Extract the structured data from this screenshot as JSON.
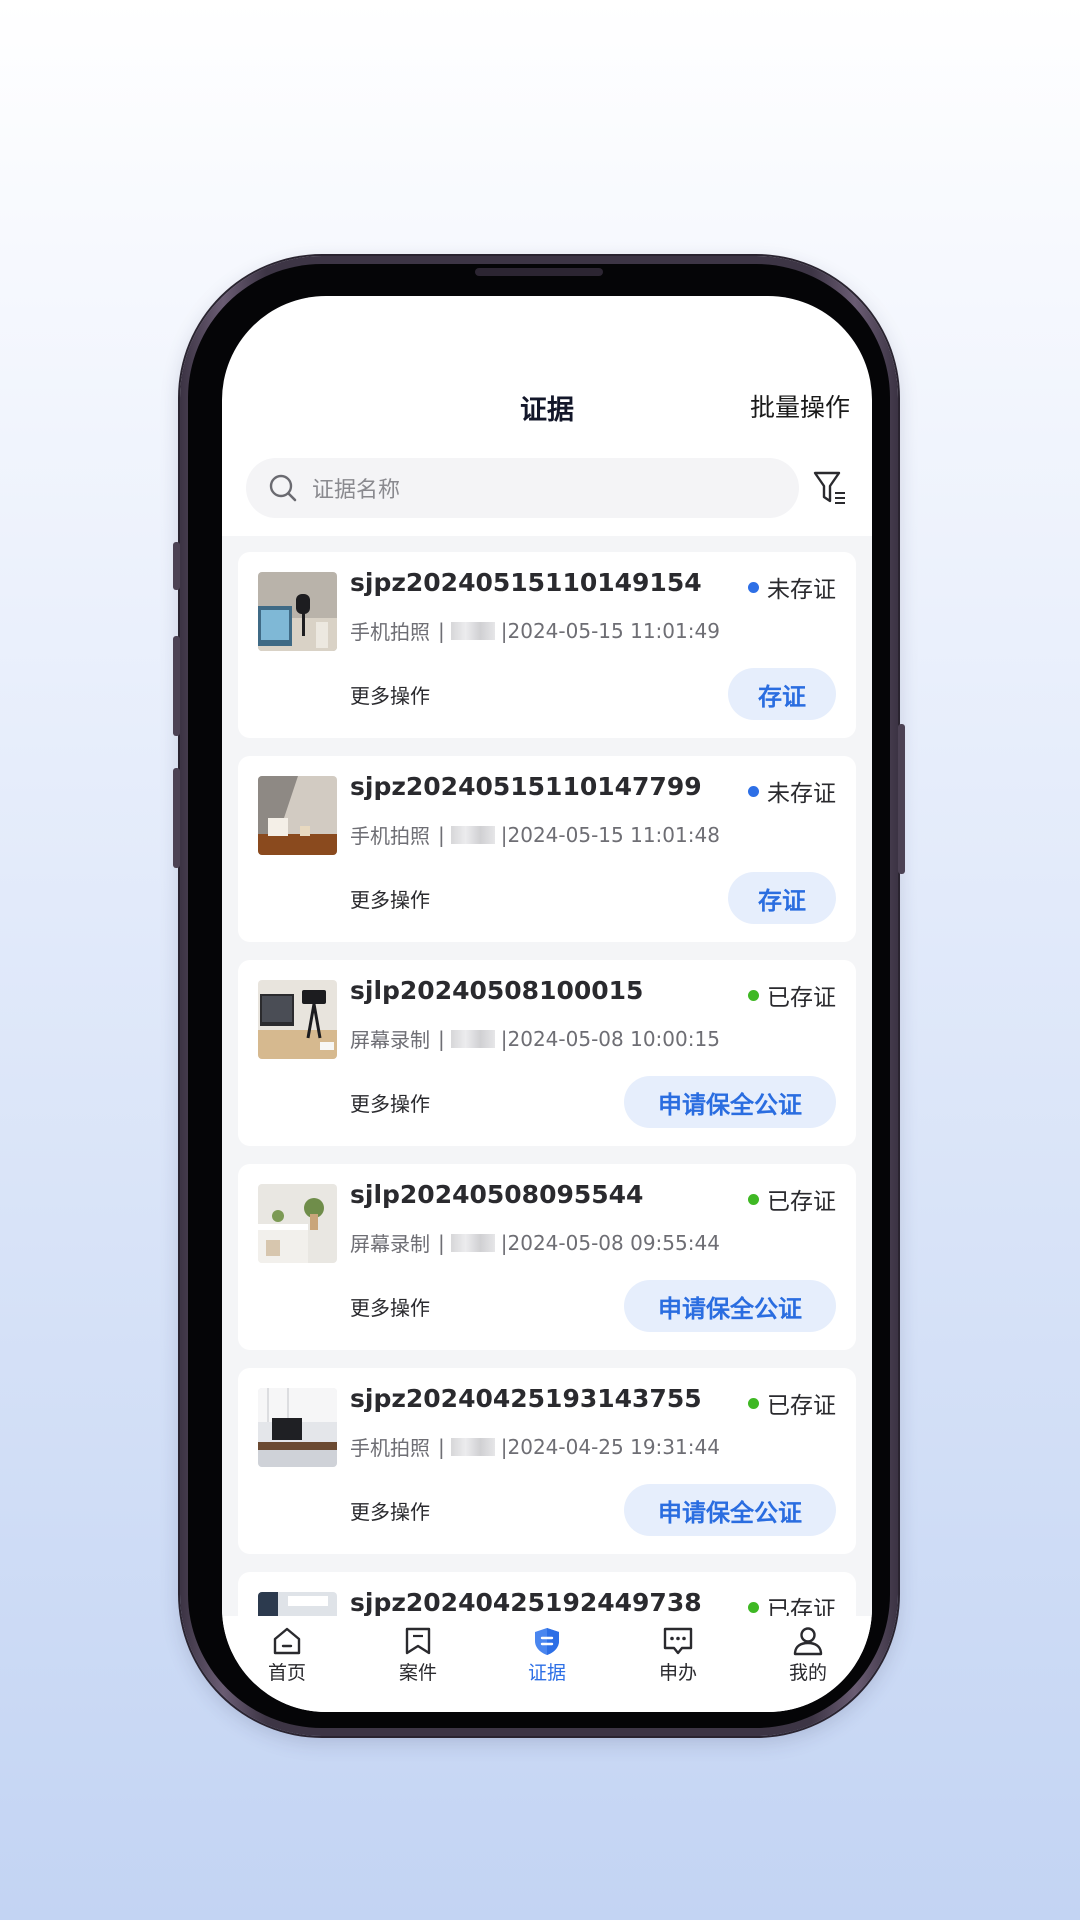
{
  "header": {
    "title": "证据",
    "batch_label": "批量操作"
  },
  "search": {
    "placeholder": "证据名称"
  },
  "evidence": [
    {
      "name": "sjpz20240515110149154",
      "status": "未存证",
      "status_color": "#2d6fe6",
      "source": "手机拍照",
      "separator": "|",
      "time": "2024-05-15 11:01:49",
      "more": "更多操作",
      "action": "存证",
      "thumb_icon": "desk-laptop-microphone-photo"
    },
    {
      "name": "sjpz20240515110147799",
      "status": "未存证",
      "status_color": "#2d6fe6",
      "source": "手机拍照",
      "separator": "|",
      "time": "2024-05-15 11:01:48",
      "more": "更多操作",
      "action": "存证",
      "thumb_icon": "desk-frame-photo"
    },
    {
      "name": "sjlp20240508100015",
      "status": "已存证",
      "status_color": "#3fb824",
      "source": "屏幕录制",
      "separator": "|",
      "time": "2024-05-08 10:00:15",
      "more": "更多操作",
      "action": "申请保全公证",
      "thumb_icon": "camera-tripod-photo"
    },
    {
      "name": "sjlp20240508095544",
      "status": "已存证",
      "status_color": "#3fb824",
      "source": "屏幕录制",
      "separator": "|",
      "time": "2024-05-08 09:55:44",
      "more": "更多操作",
      "action": "申请保全公证",
      "thumb_icon": "shelf-plant-photo"
    },
    {
      "name": "sjpz20240425193143755",
      "status": "已存证",
      "status_color": "#3fb824",
      "source": "手机拍照",
      "separator": "|",
      "time": "2024-04-25 19:31:44",
      "more": "更多操作",
      "action": "申请保全公证",
      "thumb_icon": "monitor-desk-photo"
    },
    {
      "name": "sjpz20240425192449738",
      "status": "已存证",
      "status_color": "#3fb824",
      "thumb_icon": "office-photo"
    }
  ],
  "tabs": [
    {
      "label": "首页",
      "icon": "home-icon"
    },
    {
      "label": "案件",
      "icon": "case-icon"
    },
    {
      "label": "证据",
      "icon": "evidence-shield-icon",
      "active": true
    },
    {
      "label": "申办",
      "icon": "chat-icon"
    },
    {
      "label": "我的",
      "icon": "user-icon"
    }
  ],
  "colors": {
    "accent": "#2d6fe6",
    "pending": "#2d6fe6",
    "saved": "#3fb824",
    "action_bg": "#e6eefc"
  }
}
